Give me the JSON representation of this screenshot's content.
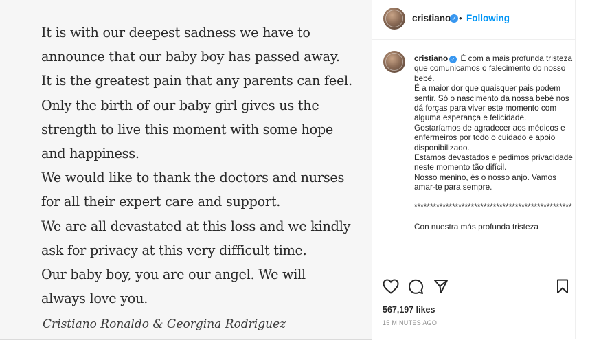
{
  "post_image": {
    "statement_lines": [
      "It is with our deepest sadness we have to",
      "announce that our baby boy has passed away.",
      "It is the greatest pain that any parents can feel.",
      "Only the birth of our baby girl gives us the",
      "strength to live this moment with some hope",
      "and happiness.",
      "We would like to thank the doctors and nurses",
      "for all their expert care and support.",
      "We are all devastated at this loss and we kindly",
      "ask for privacy at this very difficult time.",
      "Our baby boy, you are our angel. We will",
      "always love you."
    ],
    "signature": "Cristiano Ronaldo & Georgina Rodriguez"
  },
  "header": {
    "username": "cristiano",
    "dot": "•",
    "follow_status": "Following",
    "verified_glyph": "✓"
  },
  "caption": {
    "username": "cristiano",
    "verified_glyph": "✓",
    "text": " É com a mais profunda tristeza que comunicamos o falecimento do nosso bebé.\nÉ a maior dor que quaisquer pais podem sentir. Só o nascimento da nossa bebé nos dá forças para viver este momento com alguma esperança e felicidade.\nGostaríamos de agradecer aos médicos e enfermeiros por todo o cuidado e apoio disponibilizado.\nEstamos devastados e pedimos privacidade neste momento tão difícil.\nNosso menino, és o nosso anjo. Vamos amar-te para sempre.\n\n**************************************************\n\nCon nuestra más profunda tristeza"
  },
  "actions": {
    "like_icon": "heart-icon",
    "comment_icon": "comment-icon",
    "share_icon": "paper-plane-icon",
    "save_icon": "bookmark-icon"
  },
  "likes": "567,197 likes",
  "timestamp": "15 MINUTES AGO",
  "colors": {
    "accent": "#0095f6",
    "verified": "#3897f0",
    "text": "#262626",
    "muted": "#8e8e8e"
  }
}
